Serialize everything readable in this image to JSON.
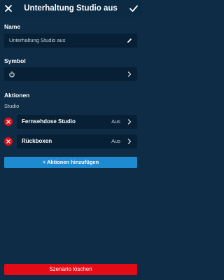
{
  "header": {
    "title": "Unterhaltung Studio aus",
    "close_icon": "close-icon",
    "confirm_icon": "check-icon"
  },
  "name_section": {
    "label": "Name",
    "value": "Unterhaltung Studio aus",
    "edit_icon": "pencil-icon"
  },
  "symbol_section": {
    "label": "Symbol",
    "symbol_icon": "power-icon",
    "chevron_icon": "chevron-right-icon"
  },
  "actions_section": {
    "label": "Aktionen",
    "group_label": "Studio",
    "items": [
      {
        "name": "Fernsehdose Studio",
        "state": "Aus",
        "remove_icon": "remove-icon"
      },
      {
        "name": "Rückboxen",
        "state": "Aus",
        "remove_icon": "remove-icon"
      }
    ],
    "add_button_label": "+ Aktionen hinzufügen"
  },
  "delete_button_label": "Szenario löschen",
  "colors": {
    "background": "#0e2c46",
    "field": "#082035",
    "accent_blue": "#1e8bd1",
    "danger_red": "#e20b16"
  }
}
